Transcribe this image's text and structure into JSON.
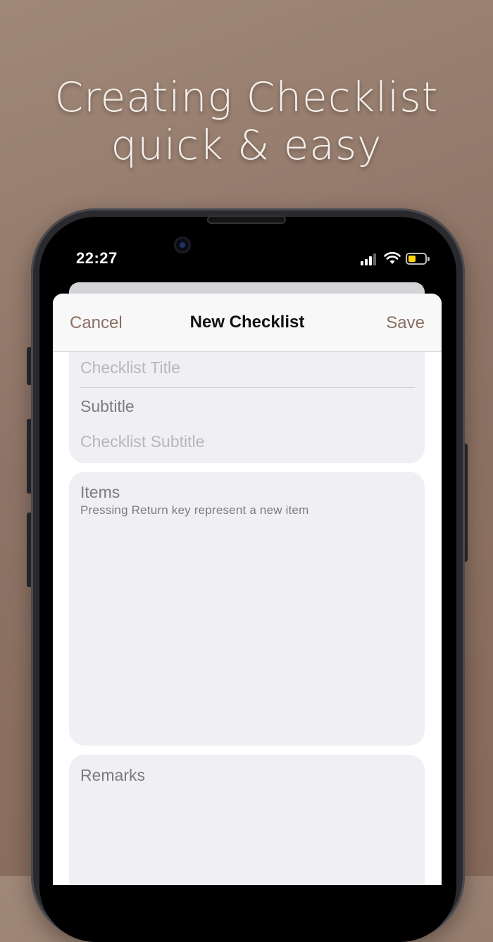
{
  "headline": {
    "line1": "Creating Checklist",
    "line2": "quick & easy"
  },
  "status_bar": {
    "time": "22:27"
  },
  "navbar": {
    "cancel": "Cancel",
    "title": "New Checklist",
    "save": "Save"
  },
  "form": {
    "title_placeholder": "Checklist Title",
    "subtitle_label": "Subtitle",
    "subtitle_placeholder": "Checklist Subtitle",
    "items_label": "Items",
    "items_hint": "Pressing Return key represent a new item",
    "remarks_label": "Remarks"
  },
  "colors": {
    "accent": "#8a6f60",
    "battery": "#ffd60a",
    "background": "#8e7466"
  }
}
